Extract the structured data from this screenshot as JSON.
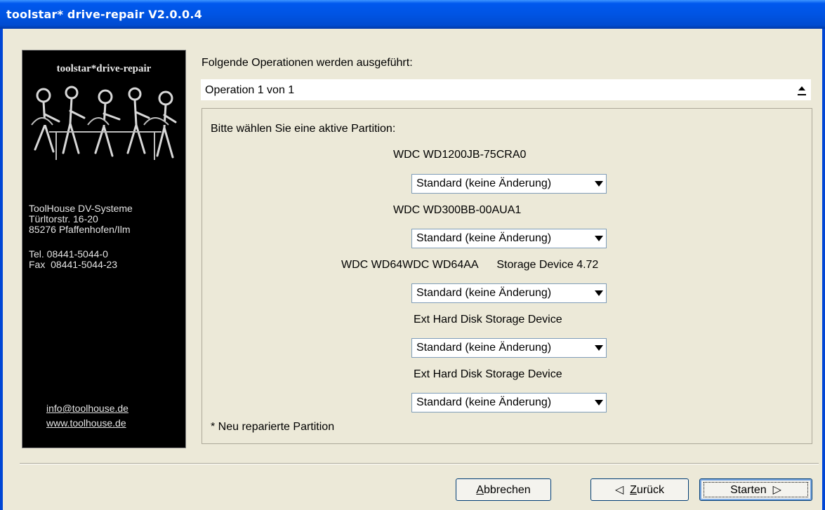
{
  "window": {
    "title": "toolstar* drive-repair V2.0.0.4"
  },
  "sidebar": {
    "brand": "toolstar*drive-repair",
    "address": [
      "ToolHouse DV-Systeme",
      "Türltorstr. 16-20",
      "85276 Pfaffenhofen/Ilm"
    ],
    "contact": [
      "Tel. 08441-5044-0",
      "Fax  08441-5044-23"
    ],
    "links": [
      "info@toolhouse.de",
      "www.toolhouse.de"
    ]
  },
  "main": {
    "heading": "Folgende Operationen werden ausgeführt:",
    "operation": "Operation 1 von 1",
    "prompt": "Bitte wählen Sie eine aktive Partition:",
    "devices": [
      {
        "name": "WDC WD1200JB-75CRA0",
        "selection": "Standard (keine Änderung)"
      },
      {
        "name": "WDC WD300BB-00AUA1",
        "selection": "Standard (keine Änderung)"
      },
      {
        "name": "WDC WD64WDC WD64AA      Storage Device 4.72",
        "selection": "Standard (keine Änderung)"
      },
      {
        "name": "Ext Hard Disk Storage Device",
        "selection": "Standard (keine Änderung)"
      },
      {
        "name": "Ext Hard Disk Storage Device",
        "selection": "Standard (keine Änderung)"
      }
    ],
    "footnote": "* Neu reparierte Partition"
  },
  "buttons": {
    "cancel_first": "A",
    "cancel_rest": "bbrechen",
    "back_arrow": "◁",
    "back_first": "Z",
    "back_rest": "urück",
    "start_label": "Starten",
    "start_arrow": "▷"
  }
}
